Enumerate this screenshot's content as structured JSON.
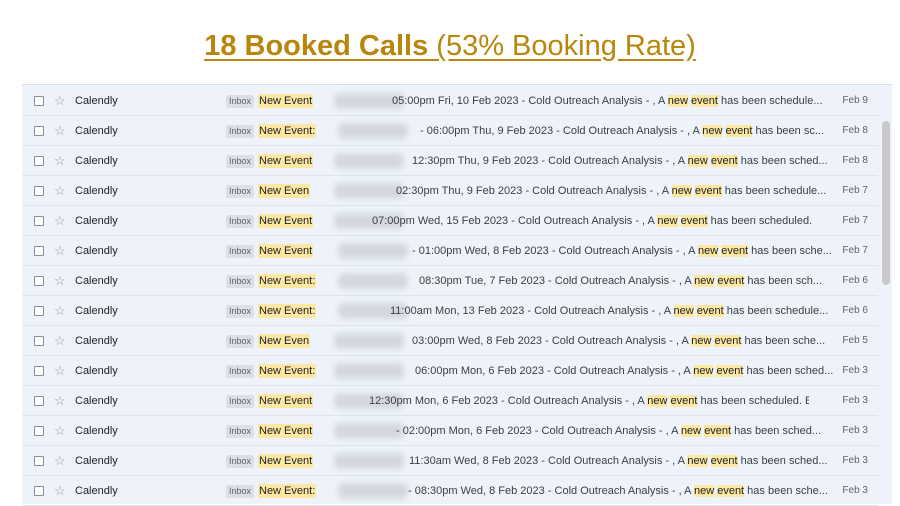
{
  "headline": {
    "bold_part": "18 Booked Calls",
    "rest_part": "(53% Booking Rate)"
  },
  "rows": [
    {
      "sender": "Calendly",
      "tag": "Inbox",
      "subject": "New Event",
      "time_text": "05:00pm Fri, 10 Feb 2023 - Cold Outreach Analysis - , A",
      "hl1": "new",
      "hl2": "event",
      "tail": " has been schedule...",
      "date": "Feb 9"
    },
    {
      "sender": "Calendly",
      "tag": "Inbox",
      "subject": "New Event:",
      "time_text": "- 06:00pm Thu, 9 Feb 2023 - Cold Outreach Analysis - , A",
      "hl1": "new",
      "hl2": "event",
      "tail": " has been sc...",
      "date": "Feb 8"
    },
    {
      "sender": "Calendly",
      "tag": "Inbox",
      "subject": "New Event",
      "time_text": "12:30pm Thu, 9 Feb 2023 - Cold Outreach Analysis - , A",
      "hl1": "new",
      "hl2": "event",
      "tail": " has been sched...",
      "date": "Feb 8"
    },
    {
      "sender": "Calendly",
      "tag": "Inbox",
      "subject": "New Even",
      "time_text": "02:30pm Thu, 9 Feb 2023 - Cold Outreach Analysis - , A",
      "hl1": "new",
      "hl2": "event",
      "tail": " has been schedule...",
      "date": "Feb 7"
    },
    {
      "sender": "Calendly",
      "tag": "Inbox",
      "subject": "New Event",
      "time_text": "07:00pm Wed, 15 Feb 2023 - Cold Outreach Analysis - , A",
      "hl1": "new",
      "hl2": "event",
      "tail": " has been scheduled. ...",
      "date": "Feb 7"
    },
    {
      "sender": "Calendly",
      "tag": "Inbox",
      "subject": "New Event",
      "time_text": "- 01:00pm Wed, 8 Feb 2023 - Cold Outreach Analysis - , A",
      "hl1": "new",
      "hl2": "event",
      "tail": " has been sche...",
      "date": "Feb 7"
    },
    {
      "sender": "Calendly",
      "tag": "Inbox",
      "subject": "New Event:",
      "time_text": "08:30pm Tue, 7 Feb 2023 - Cold Outreach Analysis - , A",
      "hl1": "new",
      "hl2": "event",
      "tail": " has been sch...",
      "date": "Feb 6"
    },
    {
      "sender": "Calendly",
      "tag": "Inbox",
      "subject": "New Event:",
      "time_text": "11:00am Mon, 13 Feb 2023 - Cold Outreach Analysis - , A",
      "hl1": "new",
      "hl2": "event",
      "tail": " has been schedule...",
      "date": "Feb 6"
    },
    {
      "sender": "Calendly",
      "tag": "Inbox",
      "subject": "New Even",
      "time_text": "03:00pm Wed, 8 Feb 2023 - Cold Outreach Analysis - , A",
      "hl1": "new",
      "hl2": "event",
      "tail": " has been sche...",
      "date": "Feb 5"
    },
    {
      "sender": "Calendly",
      "tag": "Inbox",
      "subject": "New Event:",
      "time_text": "06:00pm Mon, 6 Feb 2023 - Cold Outreach Analysis - , A",
      "hl1": "new",
      "hl2": "event",
      "tail": " has been sched...",
      "date": "Feb 3"
    },
    {
      "sender": "Calendly",
      "tag": "Inbox",
      "subject": "New Event",
      "time_text": "12:30pm Mon, 6 Feb 2023 - Cold Outreach Analysis - , A",
      "hl1": "new",
      "hl2": "event",
      "tail": " has been scheduled. Ev...",
      "date": "Feb 3"
    },
    {
      "sender": "Calendly",
      "tag": "Inbox",
      "subject": "New Event",
      "time_text": "- 02:00pm Mon, 6 Feb 2023 - Cold Outreach Analysis - , A",
      "hl1": "new",
      "hl2": "event",
      "tail": " has been sched...",
      "date": "Feb 3"
    },
    {
      "sender": "Calendly",
      "tag": "Inbox",
      "subject": "New Event",
      "time_text": "11:30am Wed, 8 Feb 2023 - Cold Outreach Analysis - , A",
      "hl1": "new",
      "hl2": "event",
      "tail": " has been sched...",
      "date": "Feb 3"
    },
    {
      "sender": "Calendly",
      "tag": "Inbox",
      "subject": "New Event:",
      "time_text": "- 08:30pm Wed, 8 Feb 2023 - Cold Outreach Analysis - , A",
      "hl1": "new",
      "hl2": "event",
      "tail": " has been sche...",
      "date": "Feb 3"
    }
  ],
  "icons": {
    "checkbox": "checkbox-icon",
    "star": "star-icon"
  },
  "colors": {
    "headline": "#b8860b",
    "highlight": "#fde8a3",
    "panel_bg": "#eef3fb"
  }
}
